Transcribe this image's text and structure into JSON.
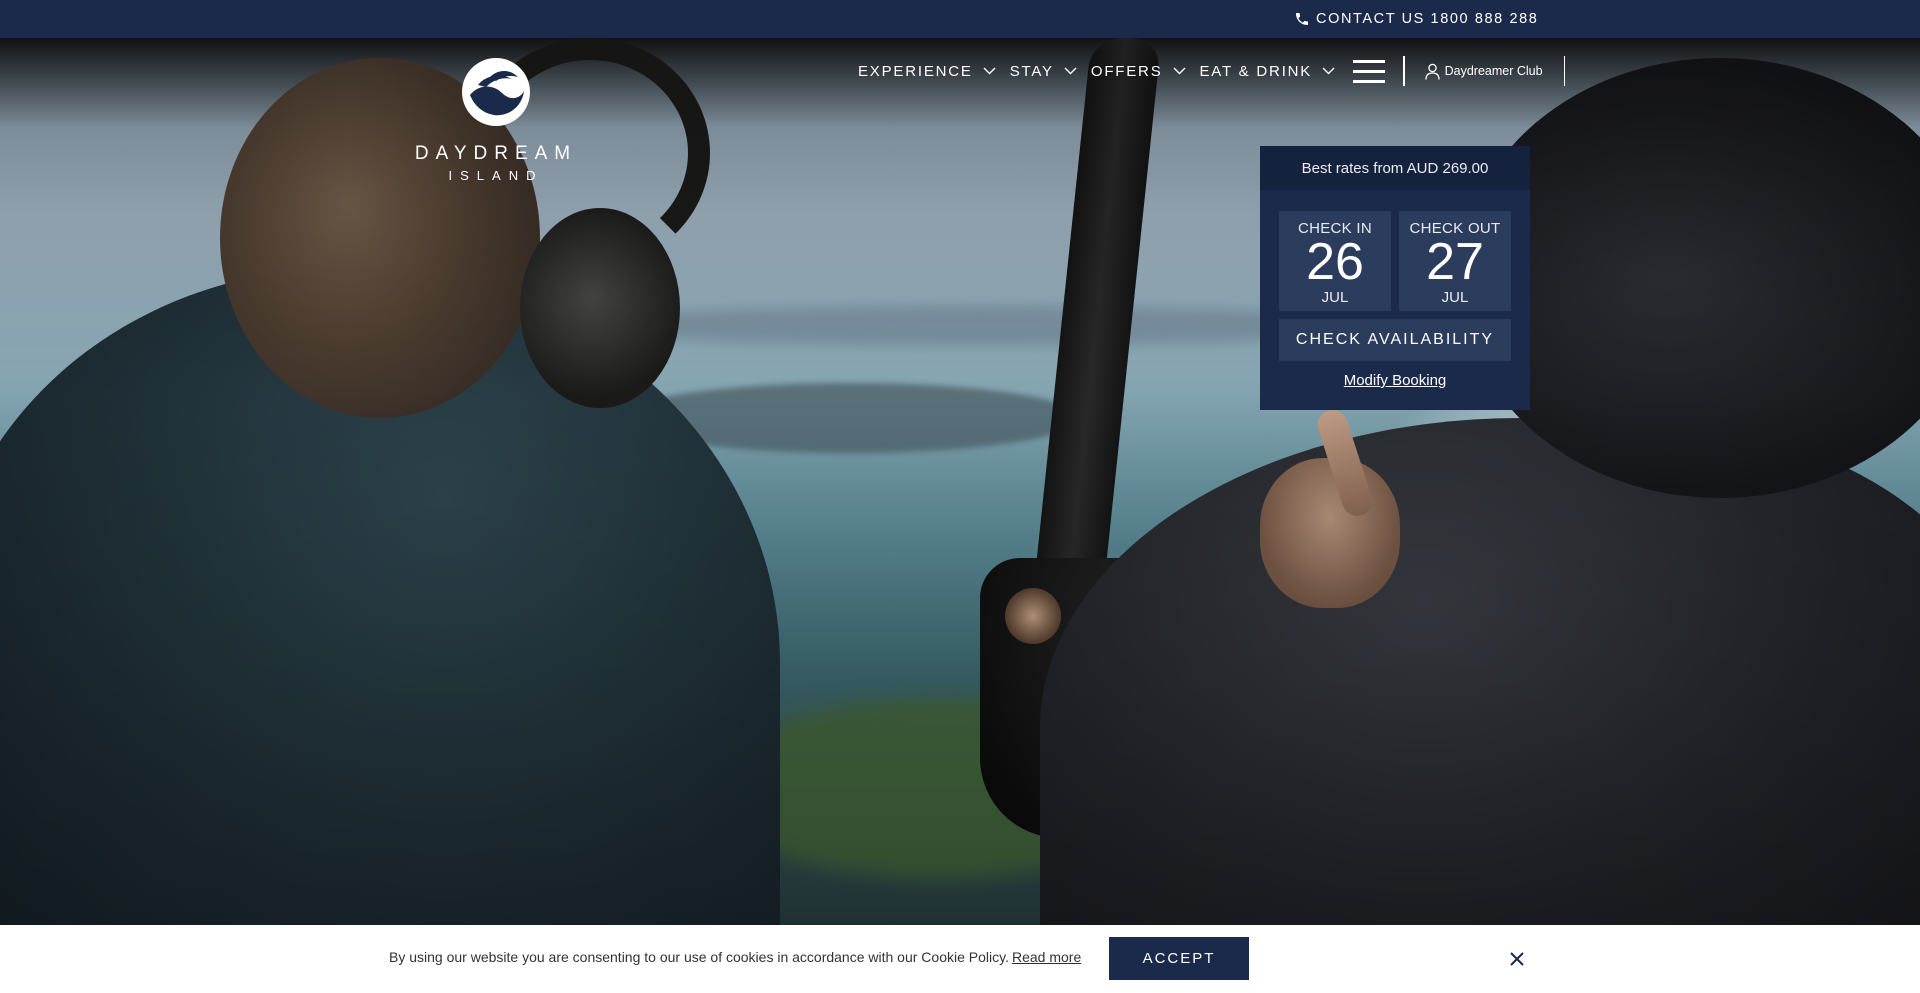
{
  "topbar": {
    "contact_label": "CONTACT US 1800 888 288",
    "icon": "phone-icon"
  },
  "logo": {
    "wordmark": "DAYDREAM",
    "subword": "ISLAND",
    "icon": "daydream-logo-icon"
  },
  "nav": {
    "items": [
      {
        "label": "EXPERIENCE"
      },
      {
        "label": "STAY"
      },
      {
        "label": "OFFERS"
      },
      {
        "label": "EAT & DRINK"
      }
    ],
    "menu_icon": "hamburger-icon",
    "club_label": "Daydreamer Club",
    "club_icon": "user-icon"
  },
  "booking": {
    "rate_text": "Best rates from AUD 269.00",
    "check_in": {
      "label": "CHECK IN",
      "day": "26",
      "month": "JUL"
    },
    "check_out": {
      "label": "CHECK OUT",
      "day": "27",
      "month": "JUL"
    },
    "button_label": "CHECK AVAILABILITY",
    "modify_label": "Modify Booking"
  },
  "cookie": {
    "text": "By using our website you are consenting to our use of cookies in accordance with our Cookie Policy.",
    "link_label": "Read more",
    "accept_label": "ACCEPT",
    "close_icon": "close-icon"
  },
  "colors": {
    "navy": "#1b2a4a",
    "navy_panel": "#2c3c5c",
    "white": "#ffffff"
  }
}
